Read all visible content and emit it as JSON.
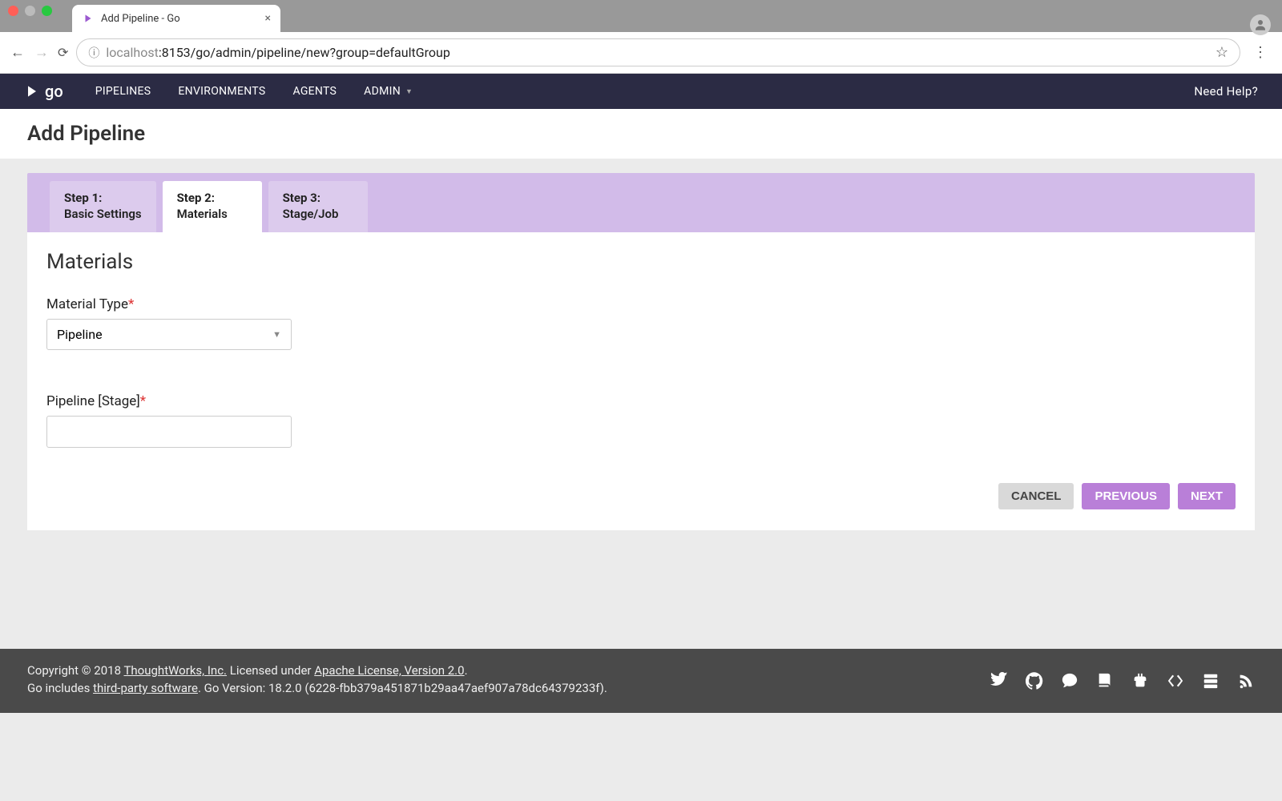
{
  "browser": {
    "tab_title": "Add Pipeline - Go",
    "url_host": "localhost",
    "url_port_path": ":8153/go/admin/pipeline/new?group=defaultGroup"
  },
  "nav": {
    "logo_text": "go",
    "items": {
      "pipelines": "PIPELINES",
      "environments": "ENVIRONMENTS",
      "agents": "AGENTS",
      "admin": "ADMIN"
    },
    "help": "Need Help?"
  },
  "page": {
    "title": "Add Pipeline"
  },
  "wizard": {
    "tabs": [
      {
        "num": "Step 1:",
        "label": "Basic Settings"
      },
      {
        "num": "Step 2:",
        "label": "Materials"
      },
      {
        "num": "Step 3:",
        "label": "Stage/Job"
      }
    ],
    "heading": "Materials",
    "material_type_label": "Material Type",
    "material_type_value": "Pipeline",
    "pipeline_stage_label": "Pipeline [Stage]",
    "pipeline_stage_value": "",
    "actions": {
      "cancel": "CANCEL",
      "previous": "PREVIOUS",
      "next": "NEXT"
    }
  },
  "footer": {
    "line1_prefix": "Copyright © 2018 ",
    "line1_company": "ThoughtWorks, Inc.",
    "line1_mid": " Licensed under ",
    "line1_license": "Apache License, Version 2.0",
    "line1_suffix": ".",
    "line2_prefix": "Go includes ",
    "line2_link": "third-party software",
    "line2_suffix": ". Go Version: 18.2.0 (6228-fbb379a451871b29aa47aef907a78dc64379233f)."
  }
}
